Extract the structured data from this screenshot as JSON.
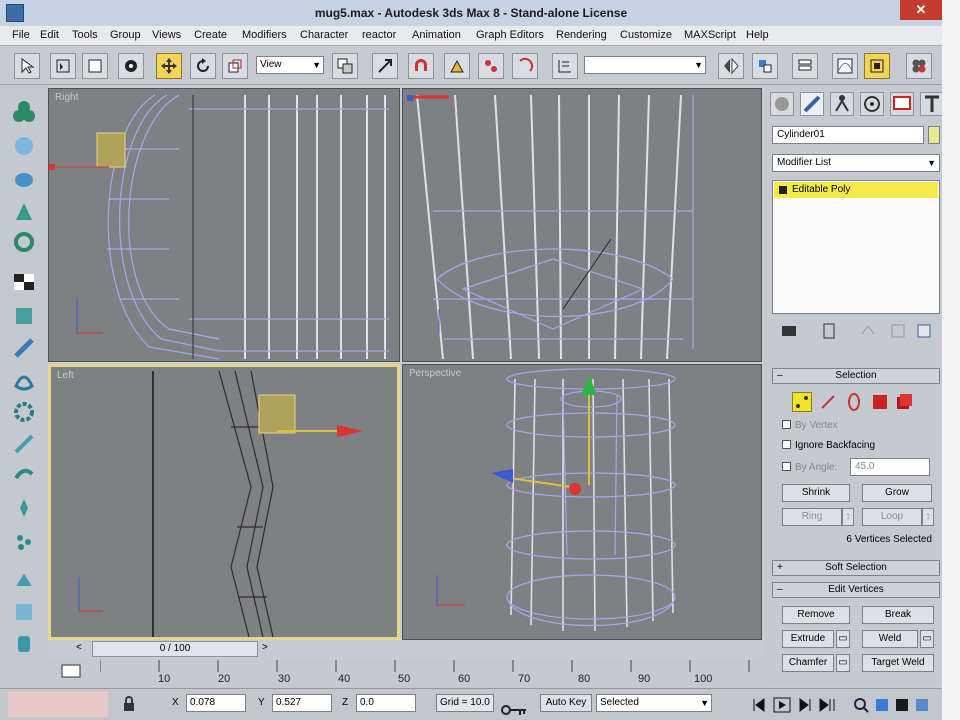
{
  "window": {
    "title": "mug5.max - Autodesk 3ds Max 8 - Stand-alone License",
    "close_glyph": "✕"
  },
  "menu": [
    "File",
    "Edit",
    "Tools",
    "Group",
    "Views",
    "Create",
    "Modifiers",
    "Character",
    "reactor",
    "Animation",
    "Graph Editors",
    "Rendering",
    "Customize",
    "MAXScript",
    "Help"
  ],
  "toolbar": {
    "reference_coord": "View",
    "named_selection": ""
  },
  "viewports": {
    "top_left": "Right",
    "top_right": "",
    "bottom_left": "Left",
    "bottom_right": "Perspective"
  },
  "command_panel": {
    "object_name": "Cylinder01",
    "modifier_list": "Modifier List",
    "stack_item": "Editable Poly",
    "selection": {
      "title": "Selection",
      "by_vertex": "By Vertex",
      "ignore_backfacing": "Ignore Backfacing",
      "by_angle": "By Angle:",
      "angle_value": "45.0",
      "shrink": "Shrink",
      "grow": "Grow",
      "ring": "Ring",
      "loop": "Loop",
      "status": "6 Vertices Selected"
    },
    "soft_selection": "Soft Selection",
    "edit_vertices": {
      "title": "Edit Vertices",
      "remove": "Remove",
      "break": "Break",
      "extrude": "Extrude",
      "weld": "Weld",
      "chamfer": "Chamfer",
      "target_weld": "Target Weld"
    }
  },
  "timeline": {
    "slider": "0 / 100",
    "ticks": [
      "10",
      "20",
      "30",
      "40",
      "50",
      "60",
      "70",
      "80",
      "90",
      "100"
    ]
  },
  "status": {
    "x_label": "X",
    "x_value": "0.078",
    "y_label": "Y",
    "y_value": "0.527",
    "z_label": "Z",
    "z_value": "0.0",
    "grid": "Grid = 10.0",
    "auto_key": "Auto Key",
    "key_mode": "Selected"
  },
  "colors": {
    "active_viewport_border": "#e4d68a",
    "selection_yellow": "#f6e94a",
    "viewport_bg": "#7f8083"
  }
}
